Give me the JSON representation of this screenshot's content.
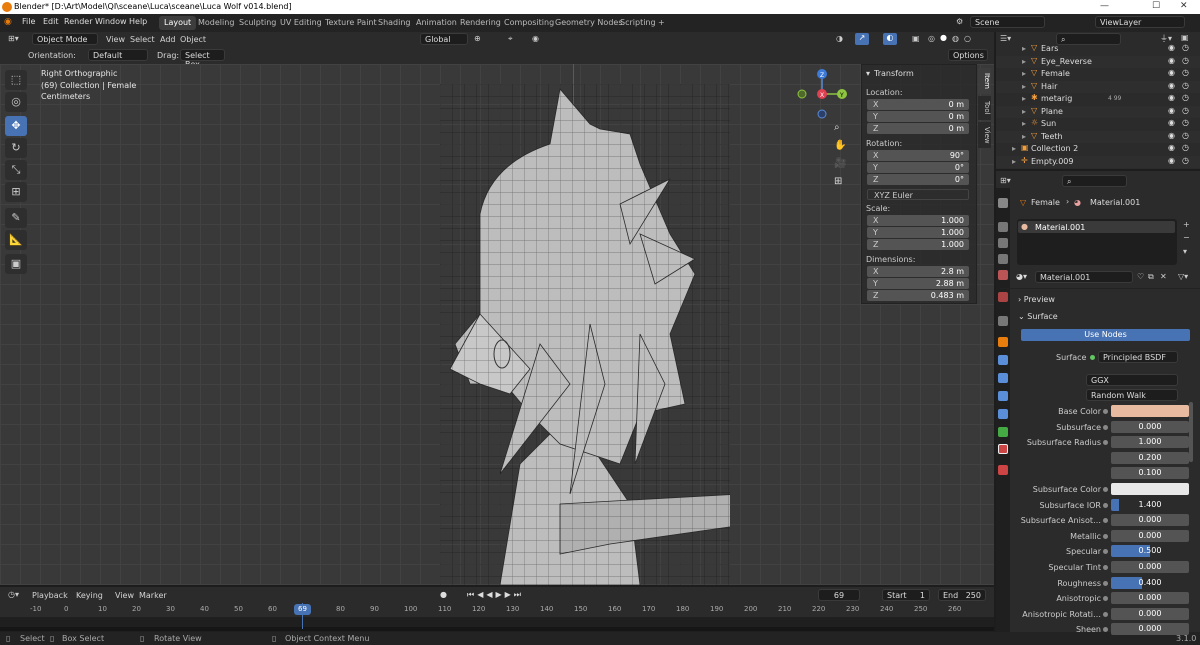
{
  "titlebar": {
    "title": "Blender* [D:\\Art\\Model\\QI\\sceane\\Luca\\sceane\\Luca Wolf v014.blend]",
    "min": "—",
    "max": "☐",
    "close": "✕"
  },
  "menus": [
    "File",
    "Edit",
    "Render",
    "Window",
    "Help"
  ],
  "workspaces": [
    "Layout",
    "Modeling",
    "Sculpting",
    "UV Editing",
    "Texture Paint",
    "Shading",
    "Animation",
    "Rendering",
    "Compositing",
    "Geometry Nodes",
    "Scripting",
    "+"
  ],
  "scene": {
    "label": "Scene",
    "viewlayer": "ViewLayer"
  },
  "viewport_header": {
    "mode": "Object Mode",
    "view": "View",
    "select": "Select",
    "add": "Add",
    "object": "Object",
    "transform": "Global"
  },
  "tool_settings": {
    "orientation_label": "Orientation:",
    "orientation": "Default",
    "drag_label": "Drag:",
    "drag": "Select Box",
    "options": "Options"
  },
  "overlay": {
    "view": "Right Orthographic",
    "collection": "(69) Collection | Female",
    "units": "Centimeters"
  },
  "gizmo": {
    "x": "X",
    "y": "Y",
    "z": "Z"
  },
  "npanel": {
    "title": "Transform",
    "location": "Location:",
    "rotation": "Rotation:",
    "scale": "Scale:",
    "dimensions": "Dimensions:",
    "euler": "XYZ Euler",
    "loc": [
      {
        "a": "X",
        "v": "0 m"
      },
      {
        "a": "Y",
        "v": "0 m"
      },
      {
        "a": "Z",
        "v": "0 m"
      }
    ],
    "rot": [
      {
        "a": "X",
        "v": "90°"
      },
      {
        "a": "Y",
        "v": "0°"
      },
      {
        "a": "Z",
        "v": "0°"
      }
    ],
    "scl": [
      {
        "a": "X",
        "v": "1.000"
      },
      {
        "a": "Y",
        "v": "1.000"
      },
      {
        "a": "Z",
        "v": "1.000"
      }
    ],
    "dim": [
      {
        "a": "X",
        "v": "2.8 m"
      },
      {
        "a": "Y",
        "v": "2.88 m"
      },
      {
        "a": "Z",
        "v": "0.483 m"
      }
    ]
  },
  "sidetabs": [
    "Item",
    "Tool",
    "View"
  ],
  "outliner": [
    {
      "name": "Ears",
      "icon": "▽"
    },
    {
      "name": "Eye_Reverse",
      "icon": "▽"
    },
    {
      "name": "Female",
      "icon": "▽"
    },
    {
      "name": "Hair",
      "icon": "▽"
    },
    {
      "name": "metarig",
      "icon": "✱"
    },
    {
      "name": "Plane",
      "icon": "▽"
    },
    {
      "name": "Sun",
      "icon": "☼"
    },
    {
      "name": "Teeth",
      "icon": "▽"
    },
    {
      "name": "Collection 2",
      "icon": "▣"
    },
    {
      "name": "Empty.009",
      "icon": "✛"
    }
  ],
  "metarig_count": "4 99",
  "props": {
    "breadcrumb_object": "Female",
    "breadcrumb_material": "Material.001",
    "slot": "Material.001",
    "material_name": "Material.001",
    "preview": "Preview",
    "surface_section": "Surface",
    "use_nodes": "Use Nodes",
    "surface_label": "Surface",
    "surface_value": "Principled BSDF",
    "distribution": "GGX",
    "ss_method": "Random Walk"
  },
  "material_rows": [
    {
      "label": "Base Color",
      "value": "",
      "color": "#e8bba0"
    },
    {
      "label": "Subsurface",
      "value": "0.000"
    },
    {
      "label": "Subsurface Radius",
      "value": "1.000"
    },
    {
      "label": "",
      "value": "0.200"
    },
    {
      "label": "",
      "value": "0.100"
    },
    {
      "label": "Subsurface Color",
      "value": "",
      "color": "#e8e8e8"
    },
    {
      "label": "Subsurface IOR",
      "value": "1.400",
      "fill": 0.1
    },
    {
      "label": "Subsurface Anisot…",
      "value": "0.000"
    },
    {
      "label": "Metallic",
      "value": "0.000"
    },
    {
      "label": "Specular",
      "value": "0.500",
      "fill": 0.5
    },
    {
      "label": "Specular Tint",
      "value": "0.000"
    },
    {
      "label": "Roughness",
      "value": "0.400",
      "fill": 0.4
    },
    {
      "label": "Anisotropic",
      "value": "0.000"
    },
    {
      "label": "Anisotropic Rotati…",
      "value": "0.000"
    },
    {
      "label": "Sheen",
      "value": "0.000"
    }
  ],
  "timeline": {
    "playback": "Playback",
    "keying": "Keying",
    "view": "View",
    "marker": "Marker",
    "current": "69",
    "start_label": "Start",
    "start": "1",
    "end_label": "End",
    "end": "250",
    "ticks": [
      "-10",
      "0",
      "10",
      "20",
      "30",
      "40",
      "50",
      "60",
      "69",
      "80",
      "90",
      "100",
      "110",
      "120",
      "130",
      "140",
      "150",
      "160",
      "170",
      "180",
      "190",
      "200",
      "210",
      "220",
      "230",
      "240",
      "250",
      "260"
    ]
  },
  "status": {
    "select": "Select",
    "box_select": "Box Select",
    "rotate": "Rotate View",
    "context": "Object Context Menu",
    "version": "3.1.0"
  }
}
